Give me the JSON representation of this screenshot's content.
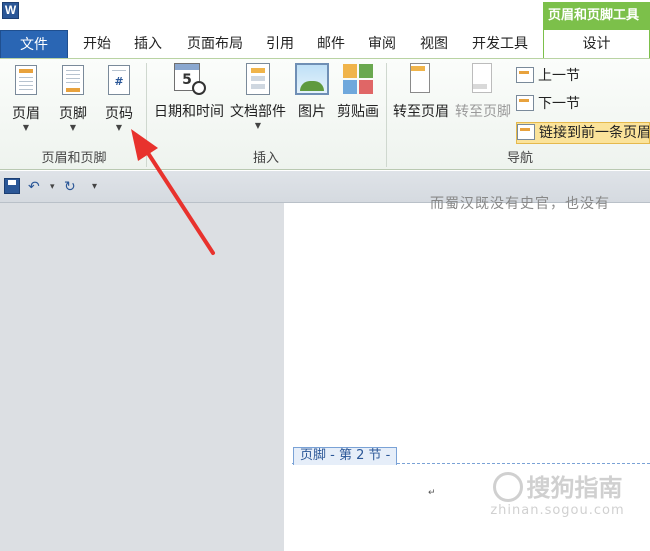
{
  "app": {
    "icon_letter": "W"
  },
  "context_tab": {
    "title": "页眉和页脚工具",
    "design_tab": "设计"
  },
  "tabs": [
    {
      "label": "文件"
    },
    {
      "label": "开始"
    },
    {
      "label": "插入"
    },
    {
      "label": "页面布局"
    },
    {
      "label": "引用"
    },
    {
      "label": "邮件"
    },
    {
      "label": "审阅"
    },
    {
      "label": "视图"
    },
    {
      "label": "开发工具"
    }
  ],
  "ribbon": {
    "group_header_footer": {
      "label": "页眉和页脚",
      "header": "页眉",
      "footer": "页脚",
      "page_number": "页码"
    },
    "group_insert": {
      "label": "插入",
      "datetime": "日期和时间",
      "datetime_icon_digit": "5",
      "quick_parts": "文档部件",
      "picture": "图片",
      "clip_art": "剪贴画"
    },
    "group_navigation": {
      "label": "导航",
      "goto_header": "转至页眉",
      "goto_footer": "转至页脚",
      "previous_section": "上一节",
      "next_section": "下一节",
      "link_to_previous": "链接到前一条页眉"
    }
  },
  "document": {
    "body_text": "而蜀汉既没有史官，也没有",
    "footer_label": "页脚 - 第 2 节 -",
    "paragraph_mark": "↵"
  },
  "watermark": {
    "text": "搜狗指南",
    "url": "zhinan.sogou.com"
  }
}
